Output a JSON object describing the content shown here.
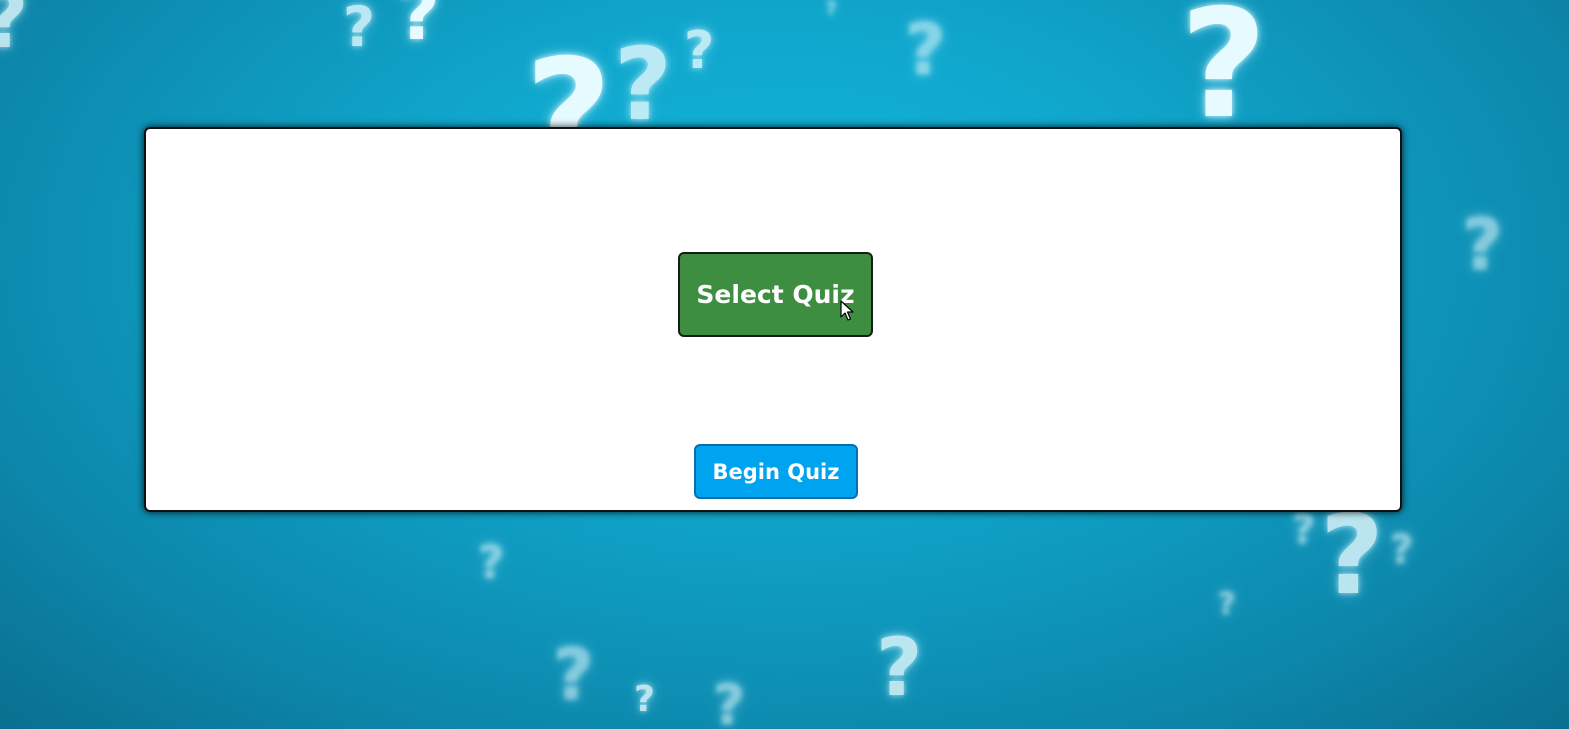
{
  "background": {
    "gradient_center": "#12b7dc",
    "gradient_edge": "#0a6f8f",
    "decoration_icon": "question-mark-icon",
    "decoration_glyph": "?"
  },
  "panel": {
    "select_quiz_label": "Select Quiz",
    "select_quiz_color": "#3e8e41",
    "begin_quiz_label": "Begin Quiz",
    "begin_quiz_color": "#00a3f0"
  },
  "cursor_icon": "mouse-pointer-icon"
}
